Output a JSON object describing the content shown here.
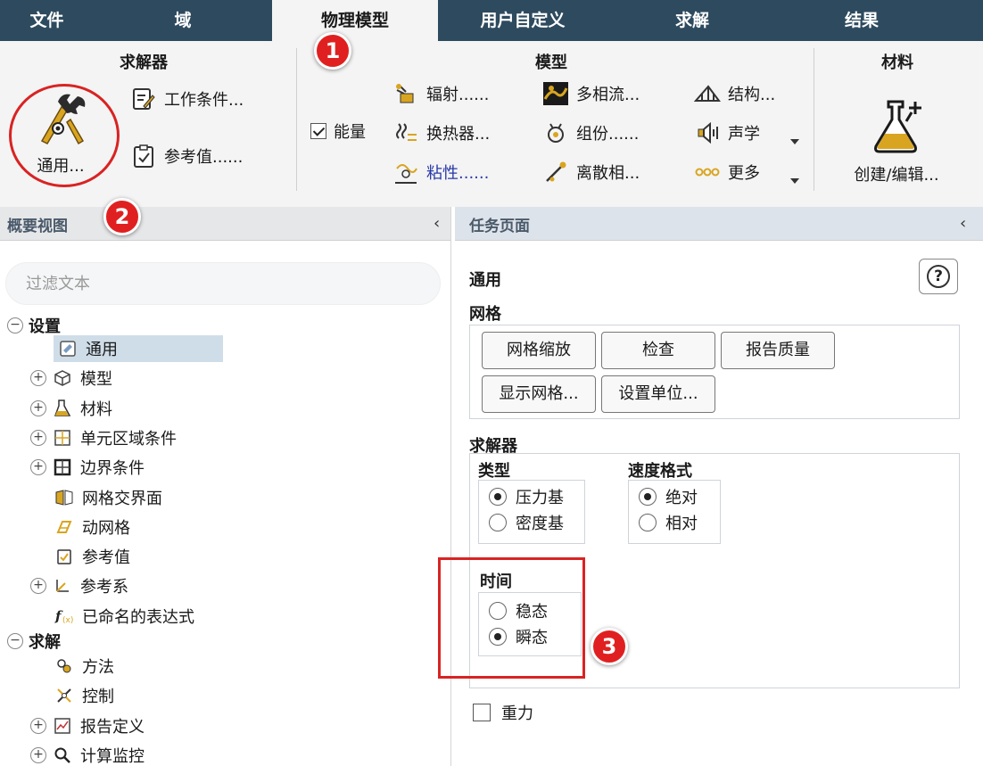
{
  "menubar": {
    "items": [
      {
        "label": "文件",
        "active": false
      },
      {
        "label": "域",
        "active": false
      },
      {
        "label": "物理模型",
        "active": true
      },
      {
        "label": "用户自定义",
        "active": false
      },
      {
        "label": "求解",
        "active": false
      },
      {
        "label": "结果",
        "active": false
      }
    ]
  },
  "ribbon": {
    "solver_group": {
      "title": "求解器",
      "general_label": "通用...",
      "operating_conditions_label": "工作条件...",
      "reference_values_label": "参考值......"
    },
    "models_group": {
      "title": "模型",
      "energy_label": "能量",
      "energy_checked": true,
      "radiation_label": "辐射......",
      "heat_exchanger_label": "换热器...",
      "viscous_label": "粘性......",
      "multiphase_label": "多相流...",
      "species_label": "组份......",
      "discrete_phase_label": "离散相...",
      "structure_label": "结构...",
      "acoustics_label": "声学",
      "more_label": "更多"
    },
    "materials_group": {
      "title": "材料",
      "create_edit_label": "创建/编辑..."
    }
  },
  "callouts": [
    "1",
    "2",
    "3"
  ],
  "outline": {
    "title": "概要视图",
    "collapse_glyph": "‹",
    "filter_placeholder": "过滤文本",
    "setup_label": "设置",
    "setup_expander": "−",
    "setup_items": [
      {
        "label": "通用",
        "expander": "",
        "icon": "general-icon",
        "selected": true
      },
      {
        "label": "模型",
        "expander": "+",
        "icon": "models-icon"
      },
      {
        "label": "材料",
        "expander": "+",
        "icon": "materials-icon"
      },
      {
        "label": "单元区域条件",
        "expander": "+",
        "icon": "cell-zone-icon"
      },
      {
        "label": "边界条件",
        "expander": "+",
        "icon": "boundary-icon"
      },
      {
        "label": "网格交界面",
        "expander": "",
        "icon": "mesh-interface-icon"
      },
      {
        "label": "动网格",
        "expander": "",
        "icon": "dynamic-mesh-icon"
      },
      {
        "label": "参考值",
        "expander": "",
        "icon": "reference-values-icon"
      },
      {
        "label": "参考系",
        "expander": "+",
        "icon": "reference-frame-icon"
      },
      {
        "label": "已命名的表达式",
        "expander": "",
        "icon": "named-expression-icon"
      }
    ],
    "solution_label": "求解",
    "solution_expander": "−",
    "solution_items": [
      {
        "label": "方法",
        "expander": "",
        "icon": "methods-icon"
      },
      {
        "label": "控制",
        "expander": "",
        "icon": "controls-icon"
      },
      {
        "label": "报告定义",
        "expander": "+",
        "icon": "report-definitions-icon"
      },
      {
        "label": "计算监控",
        "expander": "+",
        "icon": "monitors-icon"
      }
    ]
  },
  "task_page": {
    "title": "任务页面",
    "collapse_glyph": "‹",
    "page_title": "通用",
    "help_glyph": "?",
    "mesh": {
      "title": "网格",
      "scale_label": "网格缩放",
      "check_label": "检查",
      "report_quality_label": "报告质量",
      "display_label": "显示网格...",
      "units_label": "设置单位..."
    },
    "solver": {
      "title": "求解器",
      "type_title": "类型",
      "type_options": [
        {
          "label": "压力基",
          "selected": true
        },
        {
          "label": "密度基",
          "selected": false
        }
      ],
      "velocity_title": "速度格式",
      "velocity_options": [
        {
          "label": "绝对",
          "selected": true
        },
        {
          "label": "相对",
          "selected": false
        }
      ],
      "time_title": "时间",
      "time_options": [
        {
          "label": "稳态",
          "selected": false
        },
        {
          "label": "瞬态",
          "selected": true
        }
      ]
    },
    "gravity_label": "重力",
    "gravity_checked": false
  },
  "colors": {
    "menubar_bg": "#2e4a5e",
    "ribbon_bg": "#f4f4f4",
    "annotation_red": "#d92323",
    "selected_row": "#cfdde8",
    "icon_gold": "#d9a520"
  }
}
